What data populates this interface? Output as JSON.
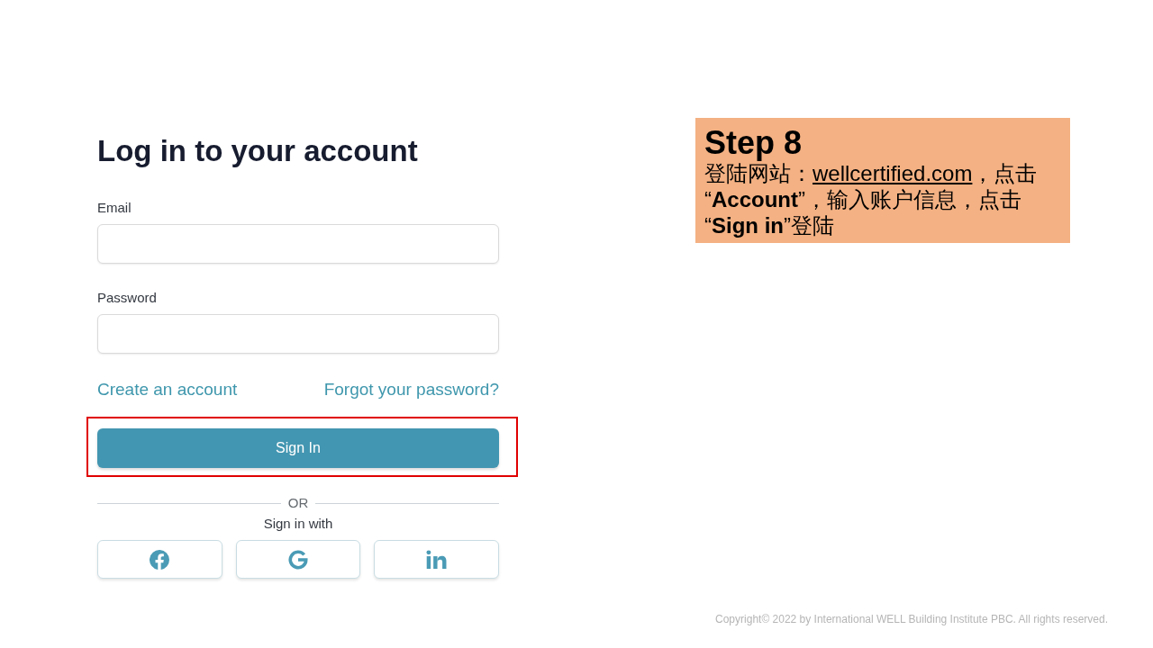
{
  "login_form": {
    "title": "Log in to your account",
    "fields": [
      {
        "label": "Email"
      },
      {
        "label": "Password"
      }
    ],
    "links": [
      "Create an account",
      "Forgot your password?"
    ],
    "submit": {
      "label": "Sign In",
      "highlighted": true
    },
    "divider": "OR",
    "social_caption": "Sign in with",
    "social_buttons": [
      {
        "kind": "facebook"
      },
      {
        "kind": "google"
      },
      {
        "kind": "linkedin"
      }
    ]
  },
  "callout": {
    "title": "Step 8",
    "body": [
      {
        "kind": "text",
        "text": "登陆网站："
      },
      {
        "kind": "link",
        "text": "wellcertified.com"
      },
      {
        "kind": "text",
        "text": "，点击"
      },
      {
        "kind": "text",
        "text": "“**Account**”，输入账户信息，点击"
      },
      {
        "kind": "text",
        "text": "“**Sign in**”登陆"
      }
    ]
  },
  "footer": "Copyright© 2022 by International WELL Building Institute PBC. All rights reserved."
}
